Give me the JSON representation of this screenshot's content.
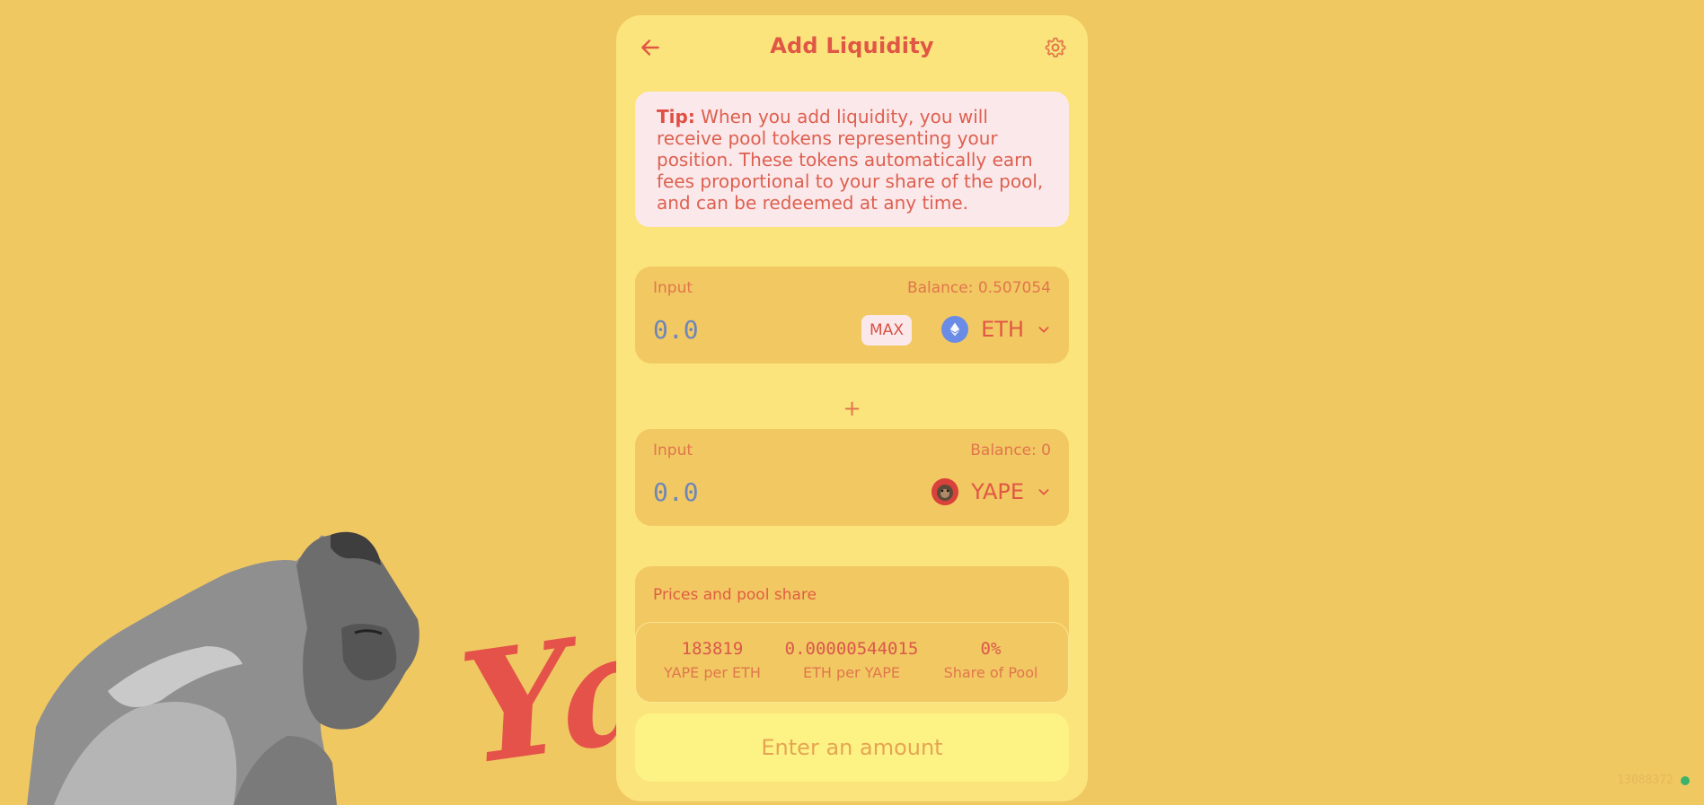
{
  "app": {
    "title": "Add Liquidity"
  },
  "tip": {
    "label": "Tip:",
    "text": "When you add liquidity, you will receive pool tokens representing your position. These tokens automatically earn fees proportional to your share of the pool, and can be redeemed at any time."
  },
  "input_a": {
    "label": "Input",
    "balance": "Balance: 0.507054",
    "placeholder": "0.0",
    "max_label": "MAX",
    "token": "ETH",
    "icon": "ethereum-icon"
  },
  "plus": "+",
  "input_b": {
    "label": "Input",
    "balance": "Balance: 0",
    "placeholder": "0.0",
    "token": "YAPE",
    "icon": "yape-token-icon"
  },
  "prices": {
    "title": "Prices and pool share",
    "stats": [
      {
        "value": "183819",
        "label": "YAPE per ETH"
      },
      {
        "value": "0.00000544015",
        "label": "ETH per YAPE"
      },
      {
        "value": "0%",
        "label": "Share of Pool"
      }
    ]
  },
  "action": {
    "label": "Enter an amount"
  },
  "background": {
    "logo_text": "Yape"
  },
  "status": {
    "block": "13088372",
    "color": "#3ab36a"
  },
  "colors": {
    "background": "#f0c862",
    "card": "#fbe47b",
    "accent": "#e05745",
    "button": "#fdf385"
  }
}
